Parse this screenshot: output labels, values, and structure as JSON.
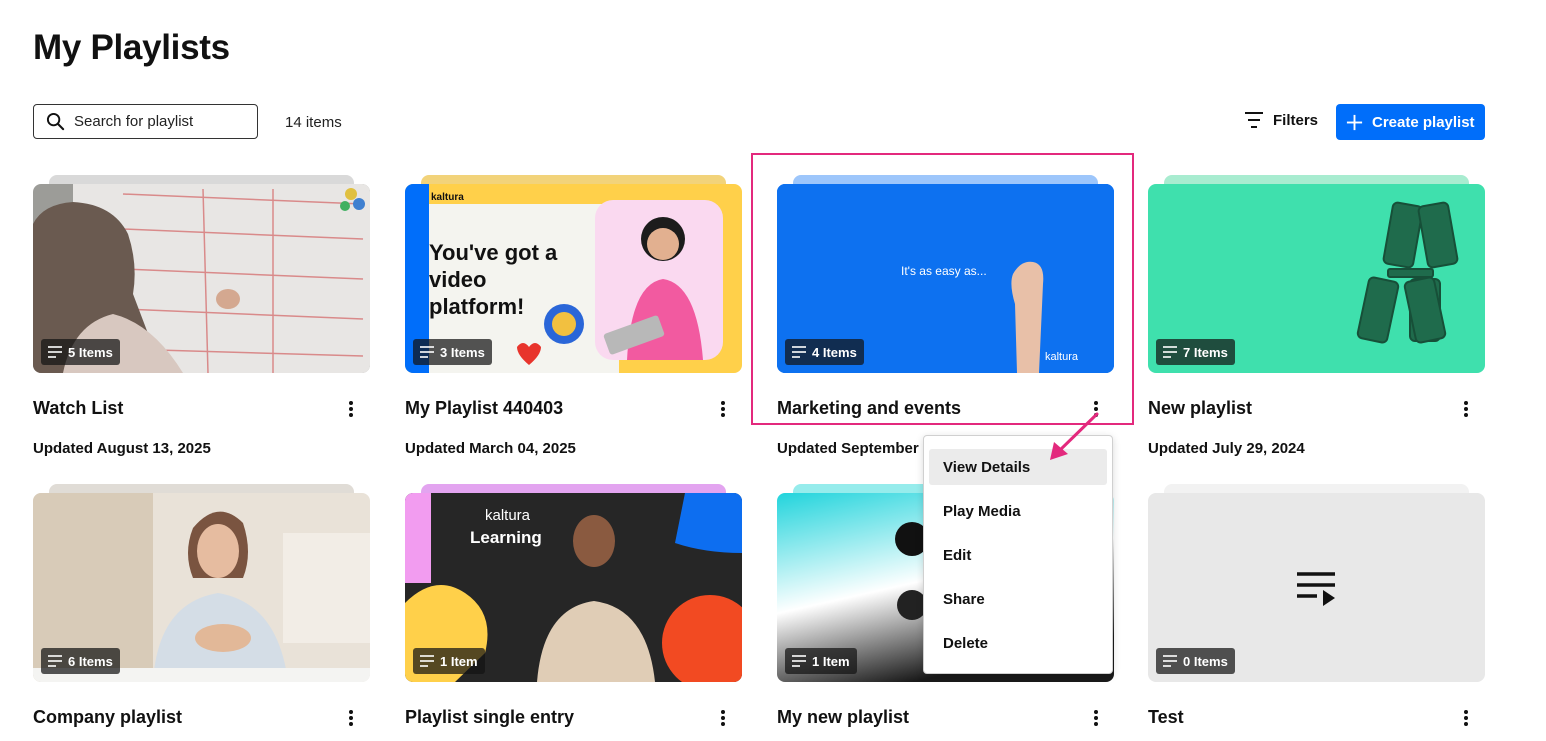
{
  "page": {
    "title": "My Playlists"
  },
  "toolbar": {
    "search_placeholder": "Search for playlist",
    "items_count": "14 items",
    "filters_label": "Filters",
    "create_label": "Create playlist",
    "accent_color": "#006efa"
  },
  "playlists": [
    {
      "title": "Watch List",
      "updated": "Updated August 13, 2025",
      "badge": "5 Items"
    },
    {
      "title": "My Playlist 440403",
      "updated": "Updated March 04, 2025",
      "badge": "3 Items"
    },
    {
      "title": "Marketing and events",
      "updated": "Updated September",
      "badge": "4 Items"
    },
    {
      "title": "New playlist",
      "updated": "Updated July 29, 2024",
      "badge": "7 Items"
    },
    {
      "title": "Company playlist",
      "updated": "",
      "badge": "6 Items"
    },
    {
      "title": "Playlist single entry",
      "updated": "",
      "badge": "1 Item"
    },
    {
      "title": "My new playlist",
      "updated": "",
      "badge": "1 Item"
    },
    {
      "title": "Test",
      "updated": "",
      "badge": "0 Items"
    }
  ],
  "thumb_text": {
    "kaltura_word": "kaltura",
    "video_platform": "You've got a video platform!",
    "easy": "It's as easy as...",
    "learning": "Learning"
  },
  "context_menu": {
    "items": [
      "View Details",
      "Play Media",
      "Edit",
      "Share",
      "Delete"
    ],
    "active": "View Details"
  },
  "annotation": {
    "highlight_color": "#e3297d"
  }
}
